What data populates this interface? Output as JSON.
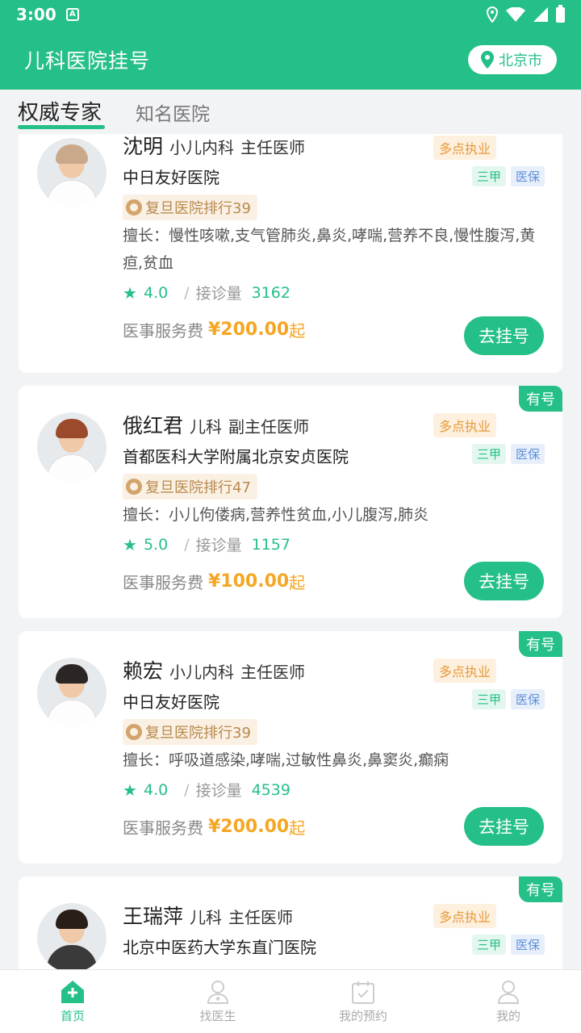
{
  "status": {
    "time": "3:00"
  },
  "header": {
    "title": "儿科医院挂号",
    "city": "北京市"
  },
  "tabs": [
    {
      "label": "权威专家",
      "active": true
    },
    {
      "label": "知名医院",
      "active": false
    }
  ],
  "cards": [
    {
      "name": "沈明",
      "dept": "小儿内科",
      "title": "主任医师",
      "multi": "多点执业",
      "hospital": "中日友好医院",
      "tag1": "三甲",
      "tag2": "医保",
      "rank": "复旦医院排行39",
      "skill_label": "擅长：",
      "skill": "慢性咳嗽,支气管肺炎,鼻炎,哮喘,营养不良,慢性腹泻,黄疸,贫血",
      "score": "4.0",
      "count_label": "接诊量",
      "count": "3162",
      "fee_label": "医事服务费",
      "price": "¥200.00",
      "price_suffix": "起",
      "button": "去挂号",
      "badge": ""
    },
    {
      "name": "俄红君",
      "dept": "儿科",
      "title": "副主任医师",
      "multi": "多点执业",
      "hospital": "首都医科大学附属北京安贞医院",
      "tag1": "三甲",
      "tag2": "医保",
      "rank": "复旦医院排行47",
      "skill_label": "擅长：",
      "skill": "小儿佝偻病,营养性贫血,小儿腹泻,肺炎",
      "score": "5.0",
      "count_label": "接诊量",
      "count": "1157",
      "fee_label": "医事服务费",
      "price": "¥100.00",
      "price_suffix": "起",
      "button": "去挂号",
      "badge": "有号"
    },
    {
      "name": "赖宏",
      "dept": "小儿内科",
      "title": "主任医师",
      "multi": "多点执业",
      "hospital": "中日友好医院",
      "tag1": "三甲",
      "tag2": "医保",
      "rank": "复旦医院排行39",
      "skill_label": "擅长：",
      "skill": "呼吸道感染,哮喘,过敏性鼻炎,鼻窦炎,癫痫",
      "score": "4.0",
      "count_label": "接诊量",
      "count": "4539",
      "fee_label": "医事服务费",
      "price": "¥200.00",
      "price_suffix": "起",
      "button": "去挂号",
      "badge": "有号"
    },
    {
      "name": "王瑞萍",
      "dept": "儿科",
      "title": "主任医师",
      "multi": "多点执业",
      "hospital": "北京中医药大学东直门医院",
      "tag1": "三甲",
      "tag2": "医保",
      "badge": "有号"
    }
  ],
  "bottom_nav": [
    {
      "label": "首页",
      "icon": "home-icon",
      "active": true
    },
    {
      "label": "找医生",
      "icon": "doctor-icon",
      "active": false
    },
    {
      "label": "我的预约",
      "icon": "calendar-check-icon",
      "active": false
    },
    {
      "label": "我的",
      "icon": "user-icon",
      "active": false
    }
  ],
  "colors": {
    "accent": "#25c088",
    "price": "#f5a623",
    "multi": "#e79a3c"
  }
}
